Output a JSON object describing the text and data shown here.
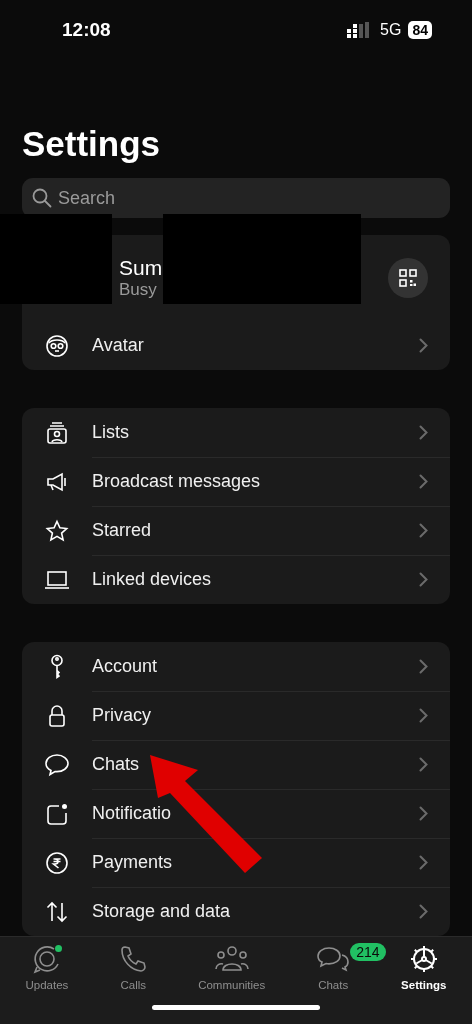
{
  "status_bar": {
    "time": "12:08",
    "network": "5G",
    "battery": "84"
  },
  "title": "Settings",
  "search": {
    "placeholder": "Search"
  },
  "profile": {
    "name": "Sum",
    "status": "Busy"
  },
  "groups": [
    [
      {
        "label": "Avatar"
      }
    ],
    [
      {
        "label": "Lists"
      },
      {
        "label": "Broadcast messages"
      },
      {
        "label": "Starred"
      },
      {
        "label": "Linked devices"
      }
    ],
    [
      {
        "label": "Account"
      },
      {
        "label": "Privacy"
      },
      {
        "label": "Chats"
      },
      {
        "label": "Notificatio"
      },
      {
        "label": "Payments"
      },
      {
        "label": "Storage and data"
      }
    ]
  ],
  "tab_bar": [
    {
      "label": "Updates",
      "selected": false,
      "dot": true
    },
    {
      "label": "Calls",
      "selected": false
    },
    {
      "label": "Communities",
      "selected": false
    },
    {
      "label": "Chats",
      "selected": false,
      "badge": "214"
    },
    {
      "label": "Settings",
      "selected": true
    }
  ]
}
